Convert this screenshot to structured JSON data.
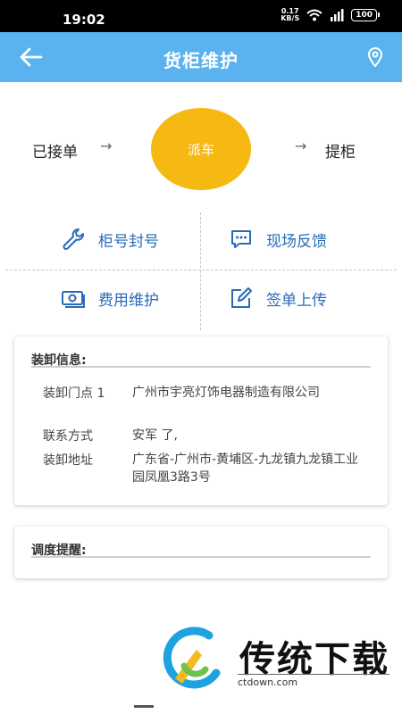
{
  "status_bar": {
    "time": "19:02",
    "net_speed": "0.17",
    "net_unit": "KB/S",
    "battery": "100"
  },
  "app_bar": {
    "title": "货柜维护",
    "back_icon": "arrow-left-icon",
    "location_icon": "map-pin-icon"
  },
  "steps": {
    "accepted": "已接单",
    "arrow": "→",
    "current": "派车",
    "pickup": "提柜"
  },
  "actions": [
    {
      "label": "柜号封号",
      "icon": "wrench-icon"
    },
    {
      "label": "现场反馈",
      "icon": "chat-bubble-icon"
    },
    {
      "label": "费用维护",
      "icon": "money-icon"
    },
    {
      "label": "签单上传",
      "icon": "edit-icon"
    }
  ],
  "loading_info": {
    "title": "装卸信息:",
    "rows": [
      {
        "key": "装卸门点 1",
        "value": "广州市宇亮灯饰电器制造有限公司"
      },
      {
        "key": "联系方式",
        "value": "安军 了,"
      },
      {
        "key": "装卸地址",
        "value": "广东省-广州市-黄埔区-九龙镇九龙镇工业园凤凰3路3号"
      }
    ]
  },
  "dispatch_reminder": {
    "title": "调度提醒:"
  },
  "watermark": {
    "text": "传统下载",
    "url": "ctdown.com"
  },
  "colors": {
    "app_bar": "#5ab3ee",
    "dispatch": "#f6b813",
    "action_text": "#2a6bb8"
  }
}
